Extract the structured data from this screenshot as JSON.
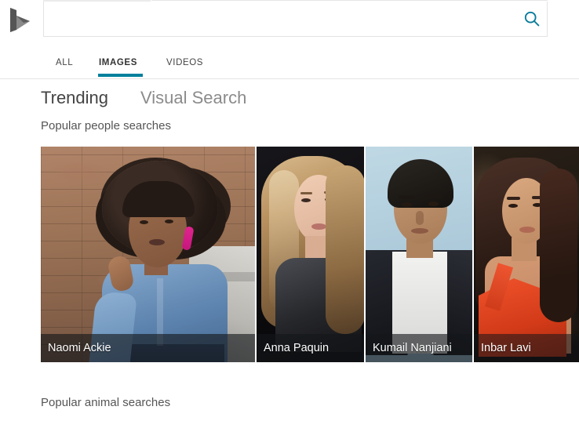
{
  "brand": {
    "logo_icon": "bing-b-logo",
    "logo_color": "#5a5a5a"
  },
  "search": {
    "value": "",
    "placeholder": "",
    "button_icon": "search-icon",
    "button_color": "#0b7c9b"
  },
  "tabs": [
    {
      "label": "ALL",
      "active": false
    },
    {
      "label": "IMAGES",
      "active": true
    },
    {
      "label": "VIDEOS",
      "active": false
    }
  ],
  "accent_color": "#00809d",
  "subnav": [
    {
      "label": "Trending",
      "active": true
    },
    {
      "label": "Visual Search",
      "active": false
    }
  ],
  "sections": {
    "people": {
      "title": "Popular people searches"
    },
    "animal": {
      "title": "Popular animal searches"
    }
  },
  "people_cards": [
    {
      "name": "Naomi Ackie"
    },
    {
      "name": "Anna Paquin"
    },
    {
      "name": "Kumail Nanjiani"
    },
    {
      "name": "Inbar Lavi"
    }
  ]
}
